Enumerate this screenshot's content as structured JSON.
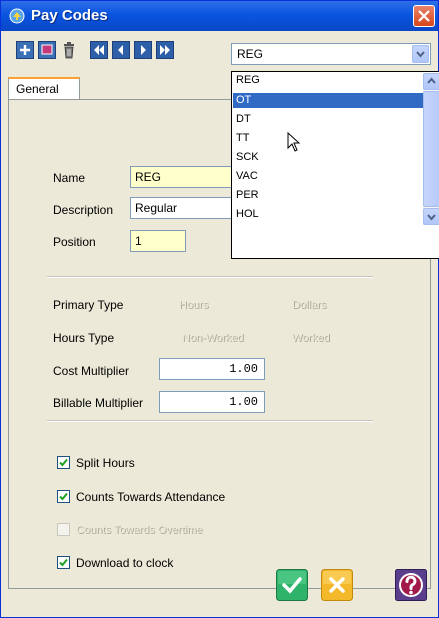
{
  "window": {
    "title": "Pay Codes"
  },
  "toolbar": {
    "buttons": [
      "add-icon",
      "save-icon",
      "delete-icon",
      "first-icon",
      "previous-icon",
      "next-icon",
      "last-icon"
    ]
  },
  "selector": {
    "value": "REG",
    "options": [
      "REG",
      "OT",
      "DT",
      "TT",
      "SCK",
      "VAC",
      "PER",
      "HOL"
    ],
    "selected_option": "OT"
  },
  "tabs": [
    {
      "label": "General"
    }
  ],
  "form": {
    "name_label": "Name",
    "name_value": "REG",
    "description_label": "Description",
    "description_value": "Regular",
    "position_label": "Position",
    "position_value": "1",
    "primary_type_label": "Primary Type",
    "primary_type_options": [
      "Hours",
      "Dollars"
    ],
    "hours_type_label": "Hours Type",
    "hours_type_options": [
      "Non-Worked",
      "Worked"
    ],
    "cost_multiplier_label": "Cost Multiplier",
    "cost_multiplier_value": "1.00",
    "billable_multiplier_label": "Billable Multiplier",
    "billable_multiplier_value": "1.00",
    "checkboxes": [
      {
        "label": "Split Hours",
        "checked": true,
        "enabled": true
      },
      {
        "label": "Counts Towards Attendance",
        "checked": true,
        "enabled": true
      },
      {
        "label": "Counts Towards Overtime",
        "checked": false,
        "enabled": false
      },
      {
        "label": "Download to clock",
        "checked": true,
        "enabled": true
      }
    ]
  },
  "colors": {
    "title_bar": "#0a55e0",
    "selection": "#316ac5",
    "field_yellow": "#ffffcc"
  }
}
